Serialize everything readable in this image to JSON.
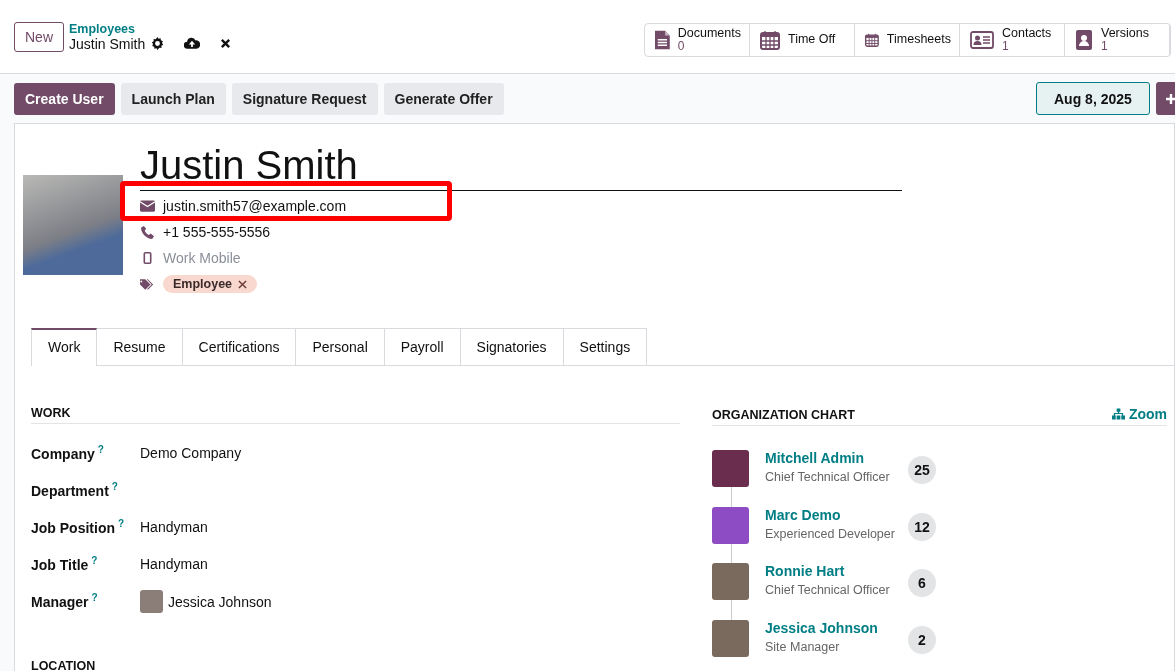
{
  "breadcrumb": {
    "parent": "Employees",
    "current": "Justin Smith"
  },
  "new_button": "New",
  "smart_buttons": [
    {
      "kind": "document",
      "label": "Documents",
      "count": "0"
    },
    {
      "kind": "calendar",
      "label": "Time Off"
    },
    {
      "kind": "calendar",
      "label": "Timesheets"
    },
    {
      "kind": "card",
      "label": "Contacts",
      "count": "1"
    },
    {
      "kind": "book",
      "label": "Versions",
      "count": "1"
    }
  ],
  "action_buttons": [
    {
      "label": "Create User",
      "primary": true
    },
    {
      "label": "Launch Plan",
      "primary": false
    },
    {
      "label": "Signature Request",
      "primary": false
    },
    {
      "label": "Generate Offer",
      "primary": false
    }
  ],
  "date_button": "Aug 8, 2025",
  "employee": {
    "name": "Justin Smith",
    "email": "justin.smith57@example.com",
    "email_highlighted": true,
    "phone": "+1 555-555-5556",
    "work_mobile_placeholder": "Work Mobile",
    "tags": [
      {
        "label": "Employee"
      }
    ]
  },
  "tabs": [
    {
      "label": "Work",
      "selected": true
    },
    {
      "label": "Resume",
      "selected": false
    },
    {
      "label": "Certifications",
      "selected": false
    },
    {
      "label": "Personal",
      "selected": false
    },
    {
      "label": "Payroll",
      "selected": false
    },
    {
      "label": "Signatories",
      "selected": false
    },
    {
      "label": "Settings",
      "selected": false
    }
  ],
  "work_section": {
    "title": "WORK",
    "fields": [
      {
        "kind": "text",
        "label": "Company",
        "help": "?",
        "value": "Demo Company"
      },
      {
        "kind": "text",
        "label": "Department",
        "help": "?"
      },
      {
        "kind": "text",
        "label": "Job Position",
        "help": "?",
        "value": "Handyman"
      },
      {
        "kind": "text",
        "label": "Job Title",
        "help": "?",
        "value": "Handyman"
      },
      {
        "kind": "user",
        "label": "Manager",
        "help": "?",
        "value": "Jessica Johnson"
      }
    ]
  },
  "location_section": {
    "title": "LOCATION"
  },
  "org_chart": {
    "title": "ORGANIZATION CHART",
    "zoom_label": "Zoom",
    "people": [
      {
        "name": "Mitchell Admin",
        "job": "Chief Technical Officer",
        "count": "25",
        "kind": "cartoon"
      },
      {
        "name": "Marc Demo",
        "job": "Experienced Developer",
        "count": "12",
        "kind": "cartoon"
      },
      {
        "name": "Ronnie Hart",
        "job": "Chief Technical Officer",
        "count": "6",
        "kind": "photo"
      },
      {
        "name": "Jessica Johnson",
        "job": "Site Manager",
        "count": "2",
        "kind": "photo"
      }
    ]
  }
}
